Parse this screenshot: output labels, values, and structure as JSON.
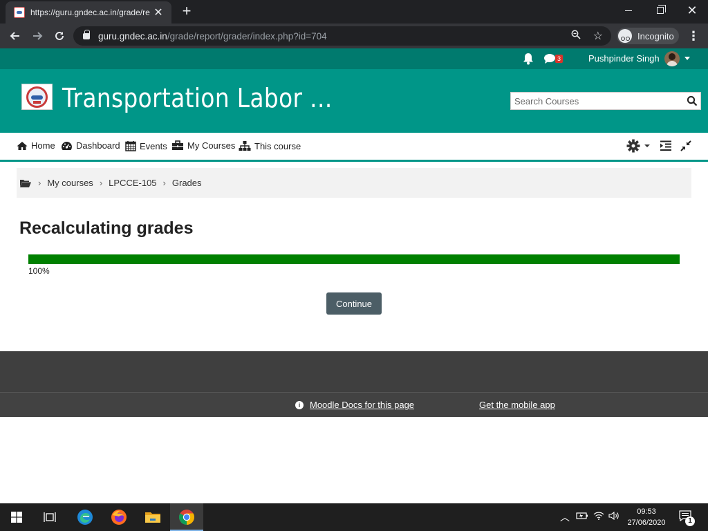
{
  "browser": {
    "tab_title": "https://guru.gndec.ac.in/grade/re",
    "tab_close": "✕",
    "new_tab": "+",
    "url_host": "guru.gndec.ac.in",
    "url_path": "/grade/report/grader/index.php?id=704",
    "incognito_label": "Incognito"
  },
  "topbar": {
    "message_count": "3",
    "username": "Pushpinder Singh"
  },
  "header": {
    "site_title": "Transportation Labor ...",
    "search_placeholder": "Search Courses"
  },
  "nav": {
    "items": [
      {
        "label": "Home",
        "icon": "home-icon"
      },
      {
        "label": "Dashboard",
        "icon": "dashboard-icon"
      },
      {
        "label": "Events",
        "icon": "calendar-icon"
      },
      {
        "label": "My Courses",
        "icon": "briefcase-icon"
      },
      {
        "label": "This course",
        "icon": "sitemap-icon"
      }
    ]
  },
  "breadcrumb": {
    "items": [
      "My courses",
      "LPCCE-105",
      "Grades"
    ]
  },
  "main": {
    "heading": "Recalculating grades",
    "progress_percent": 100,
    "progress_label": "100%",
    "continue_label": "Continue"
  },
  "footer": {
    "docs_link": "Moodle Docs for this page",
    "mobile_link": "Get the mobile app"
  },
  "taskbar": {
    "time": "09:53",
    "date": "27/06/2020",
    "notification_count": "1"
  },
  "colors": {
    "brand": "#009688",
    "brand_dark": "#007a6e",
    "progress": "#008000",
    "button": "#4c5e66",
    "footer": "#3f3f3f"
  }
}
